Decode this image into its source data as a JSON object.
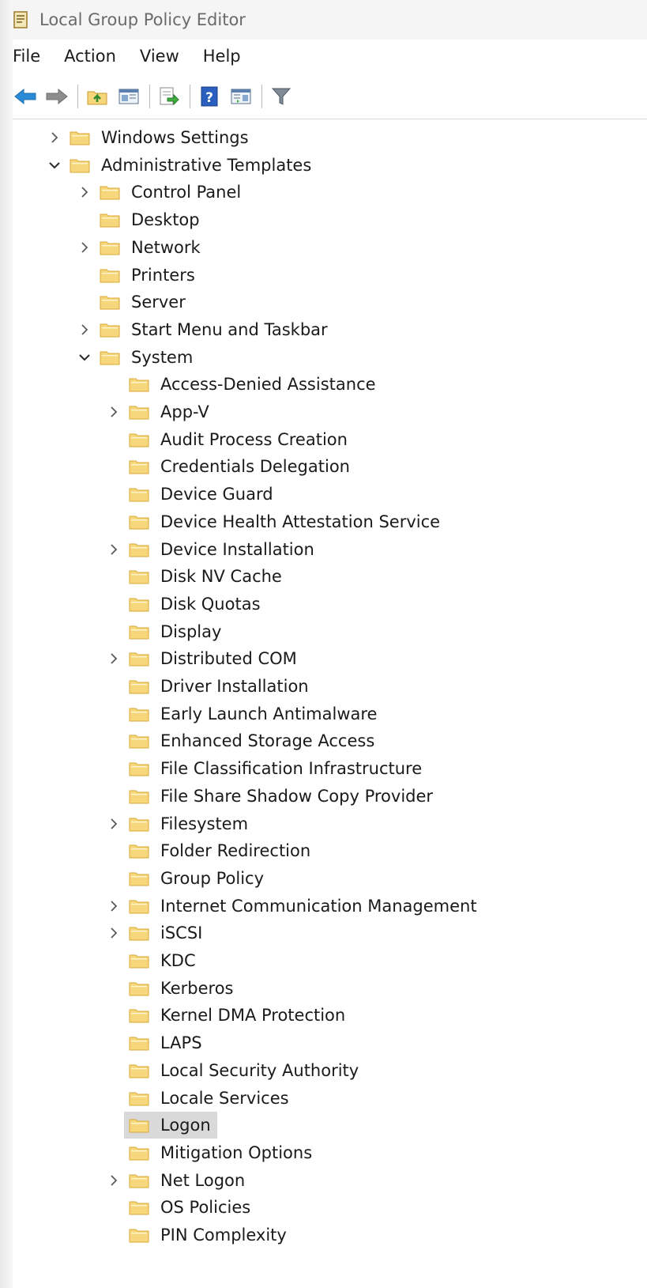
{
  "window": {
    "title": "Local Group Policy Editor"
  },
  "menu": [
    "File",
    "Action",
    "View",
    "Help"
  ],
  "toolbar": {
    "buttons": [
      "back-arrow-icon",
      "forward-arrow-icon",
      "up-folder-icon",
      "show-hide-tree-icon",
      "export-list-icon",
      "help-icon",
      "show-hide-action-pane-icon",
      "filter-icon"
    ]
  },
  "tree": [
    {
      "label": "Windows Settings",
      "level": 1,
      "expander": "collapsed"
    },
    {
      "label": "Administrative Templates",
      "level": 1,
      "expander": "expanded"
    },
    {
      "label": "Control Panel",
      "level": 2,
      "expander": "collapsed"
    },
    {
      "label": "Desktop",
      "level": 2,
      "expander": "none"
    },
    {
      "label": "Network",
      "level": 2,
      "expander": "collapsed"
    },
    {
      "label": "Printers",
      "level": 2,
      "expander": "none"
    },
    {
      "label": "Server",
      "level": 2,
      "expander": "none"
    },
    {
      "label": "Start Menu and Taskbar",
      "level": 2,
      "expander": "collapsed"
    },
    {
      "label": "System",
      "level": 2,
      "expander": "expanded"
    },
    {
      "label": "Access-Denied Assistance",
      "level": 3,
      "expander": "none"
    },
    {
      "label": "App-V",
      "level": 3,
      "expander": "collapsed"
    },
    {
      "label": "Audit Process Creation",
      "level": 3,
      "expander": "none"
    },
    {
      "label": "Credentials Delegation",
      "level": 3,
      "expander": "none"
    },
    {
      "label": "Device Guard",
      "level": 3,
      "expander": "none"
    },
    {
      "label": "Device Health Attestation Service",
      "level": 3,
      "expander": "none"
    },
    {
      "label": "Device Installation",
      "level": 3,
      "expander": "collapsed"
    },
    {
      "label": "Disk NV Cache",
      "level": 3,
      "expander": "none"
    },
    {
      "label": "Disk Quotas",
      "level": 3,
      "expander": "none"
    },
    {
      "label": "Display",
      "level": 3,
      "expander": "none"
    },
    {
      "label": "Distributed COM",
      "level": 3,
      "expander": "collapsed"
    },
    {
      "label": "Driver Installation",
      "level": 3,
      "expander": "none"
    },
    {
      "label": "Early Launch Antimalware",
      "level": 3,
      "expander": "none"
    },
    {
      "label": "Enhanced Storage Access",
      "level": 3,
      "expander": "none"
    },
    {
      "label": "File Classification Infrastructure",
      "level": 3,
      "expander": "none"
    },
    {
      "label": "File Share Shadow Copy Provider",
      "level": 3,
      "expander": "none"
    },
    {
      "label": "Filesystem",
      "level": 3,
      "expander": "collapsed"
    },
    {
      "label": "Folder Redirection",
      "level": 3,
      "expander": "none"
    },
    {
      "label": "Group Policy",
      "level": 3,
      "expander": "none"
    },
    {
      "label": "Internet Communication Management",
      "level": 3,
      "expander": "collapsed"
    },
    {
      "label": "iSCSI",
      "level": 3,
      "expander": "collapsed"
    },
    {
      "label": "KDC",
      "level": 3,
      "expander": "none"
    },
    {
      "label": "Kerberos",
      "level": 3,
      "expander": "none"
    },
    {
      "label": "Kernel DMA Protection",
      "level": 3,
      "expander": "none"
    },
    {
      "label": "LAPS",
      "level": 3,
      "expander": "none"
    },
    {
      "label": "Local Security Authority",
      "level": 3,
      "expander": "none"
    },
    {
      "label": "Locale Services",
      "level": 3,
      "expander": "none"
    },
    {
      "label": "Logon",
      "level": 3,
      "expander": "none",
      "selected": true
    },
    {
      "label": "Mitigation Options",
      "level": 3,
      "expander": "none"
    },
    {
      "label": "Net Logon",
      "level": 3,
      "expander": "collapsed"
    },
    {
      "label": "OS Policies",
      "level": 3,
      "expander": "none"
    },
    {
      "label": "PIN Complexity",
      "level": 3,
      "expander": "none"
    }
  ],
  "colors": {
    "folder_fill": "#f6d77c",
    "folder_outline": "#d9a93a",
    "selection": "#d9d9d9",
    "back_arrow": "#2a8ad6"
  }
}
